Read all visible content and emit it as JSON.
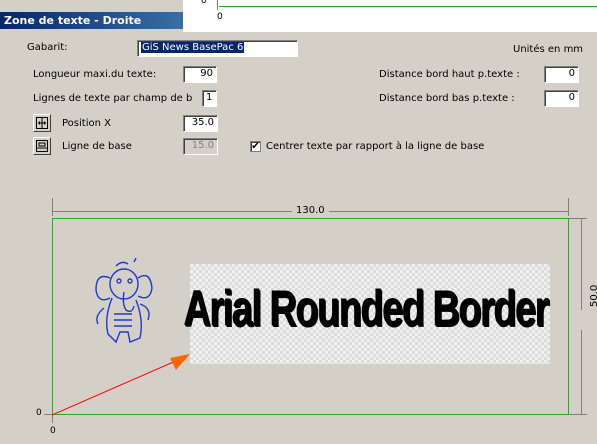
{
  "window": {
    "title": "Zone de texte - Droite"
  },
  "top_ruler": {
    "tick_top": "0",
    "tick_bottom": "0"
  },
  "form": {
    "gabarit_label": "Gabarit:",
    "gabarit_value": "GiS News BasePac 6",
    "units_label": "Unités en mm",
    "longueur_label": "Longueur maxi.du texte:",
    "longueur_value": "90",
    "lignes_label": "Lignes de texte par champ de b",
    "lignes_value": "1",
    "position_x_label": "Position X",
    "position_x_value": "35.0",
    "ligne_base_label": "Ligne de base",
    "ligne_base_value": "15.0",
    "dist_haut_label": "Distance bord haut p.texte :",
    "dist_haut_value": "0",
    "dist_bas_label": "Distance bord bas p.texte :",
    "dist_bas_value": "0",
    "centrer_label": "Centrer texte par rapport à la ligne de base",
    "centrer_checked": "✔"
  },
  "preview": {
    "width_label": "130.0",
    "height_label": "50.0",
    "origin_y": "0",
    "origin_x": "0",
    "sample_text": "Arial Rounded Border",
    "frame_color": "#22b022",
    "arrow_color": "#ff6600",
    "logo_color": "#2038d0"
  }
}
